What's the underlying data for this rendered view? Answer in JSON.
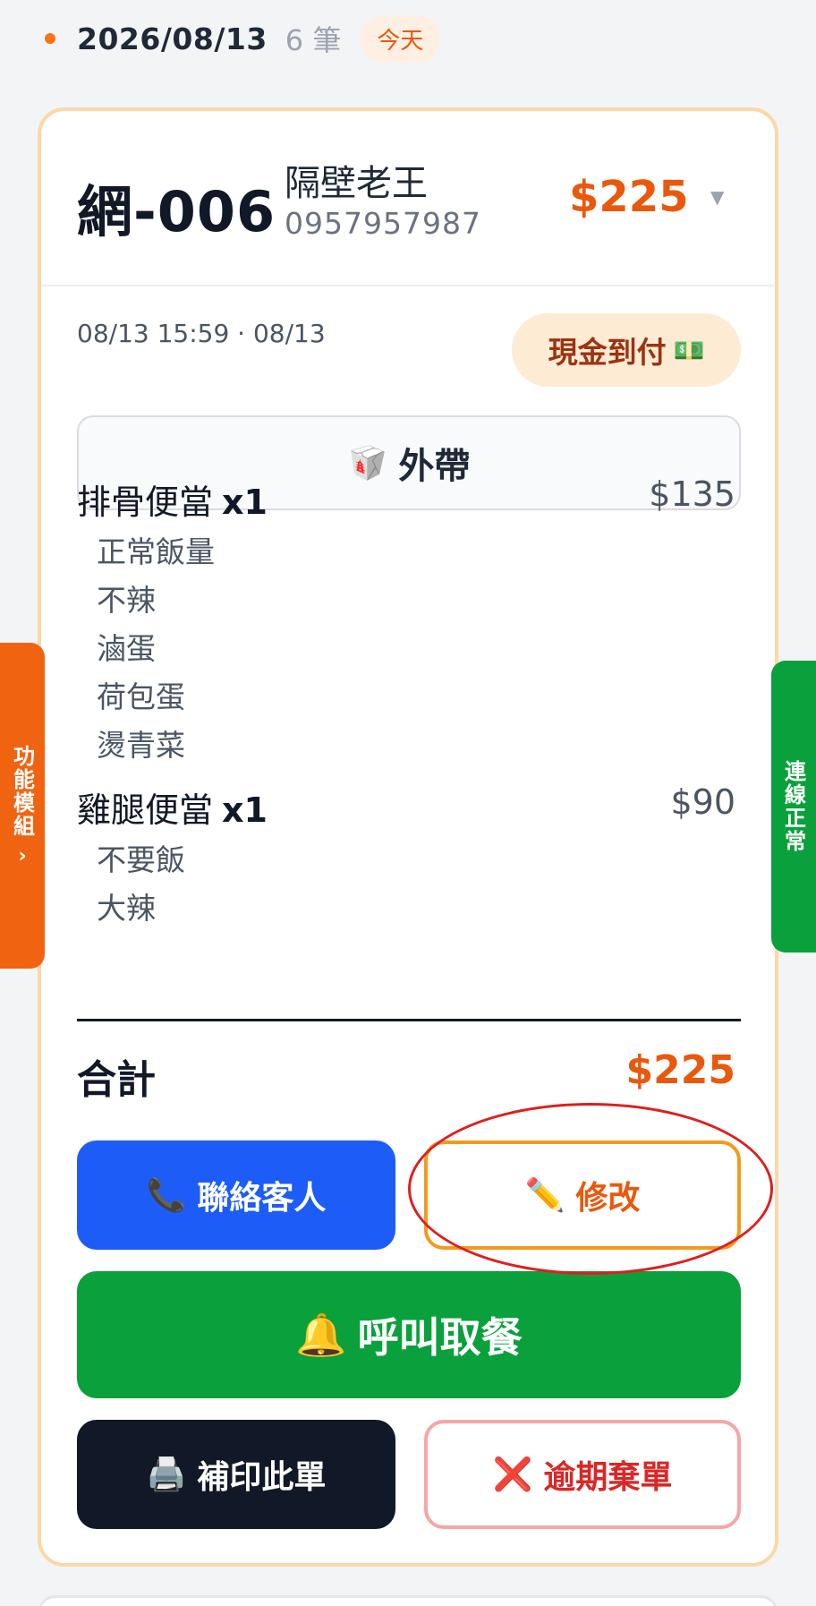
{
  "date_header": {
    "date": "2026/08/13",
    "count": "6 筆",
    "today_badge": "今天"
  },
  "order": {
    "number": "網-006",
    "customer_name": "隔壁老王",
    "customer_phone": "0957957987",
    "total": "$225",
    "time_info": "08/13 15:59 · 08/13",
    "payment": "現金到付",
    "payment_icon": "💵",
    "order_type_icon": "🥡",
    "order_type": "外帶",
    "items": [
      {
        "name": "排骨便當",
        "qty": "x1",
        "price": "$135",
        "options": [
          "正常飯量",
          "不辣",
          "滷蛋",
          "荷包蛋",
          "燙青菜"
        ]
      },
      {
        "name": "雞腿便當",
        "qty": "x1",
        "price": "$90",
        "options": [
          "不要飯",
          "大辣"
        ]
      }
    ],
    "sum_label": "合計",
    "sum_value": "$225"
  },
  "actions": {
    "contact": {
      "icon": "📞",
      "label": "聯絡客人"
    },
    "edit": {
      "icon": "✏️",
      "label": "修改"
    },
    "call": {
      "icon": "🔔",
      "label": "呼叫取餐"
    },
    "reprint": {
      "icon": "🖨️",
      "label": "補印此單"
    },
    "expire": {
      "icon": "❌",
      "label": "逾期棄單"
    }
  },
  "side_tabs": {
    "left_label": "功能模組",
    "left_chevron": "›",
    "right_label": "連線正常"
  },
  "colors": {
    "accent_orange": "#ea580c",
    "contact_blue": "#1d5cf7",
    "call_green": "#0aa03c",
    "reprint_dark": "#111827",
    "expire_red": "#dc2626",
    "annotation_red": "#e11d1d"
  }
}
